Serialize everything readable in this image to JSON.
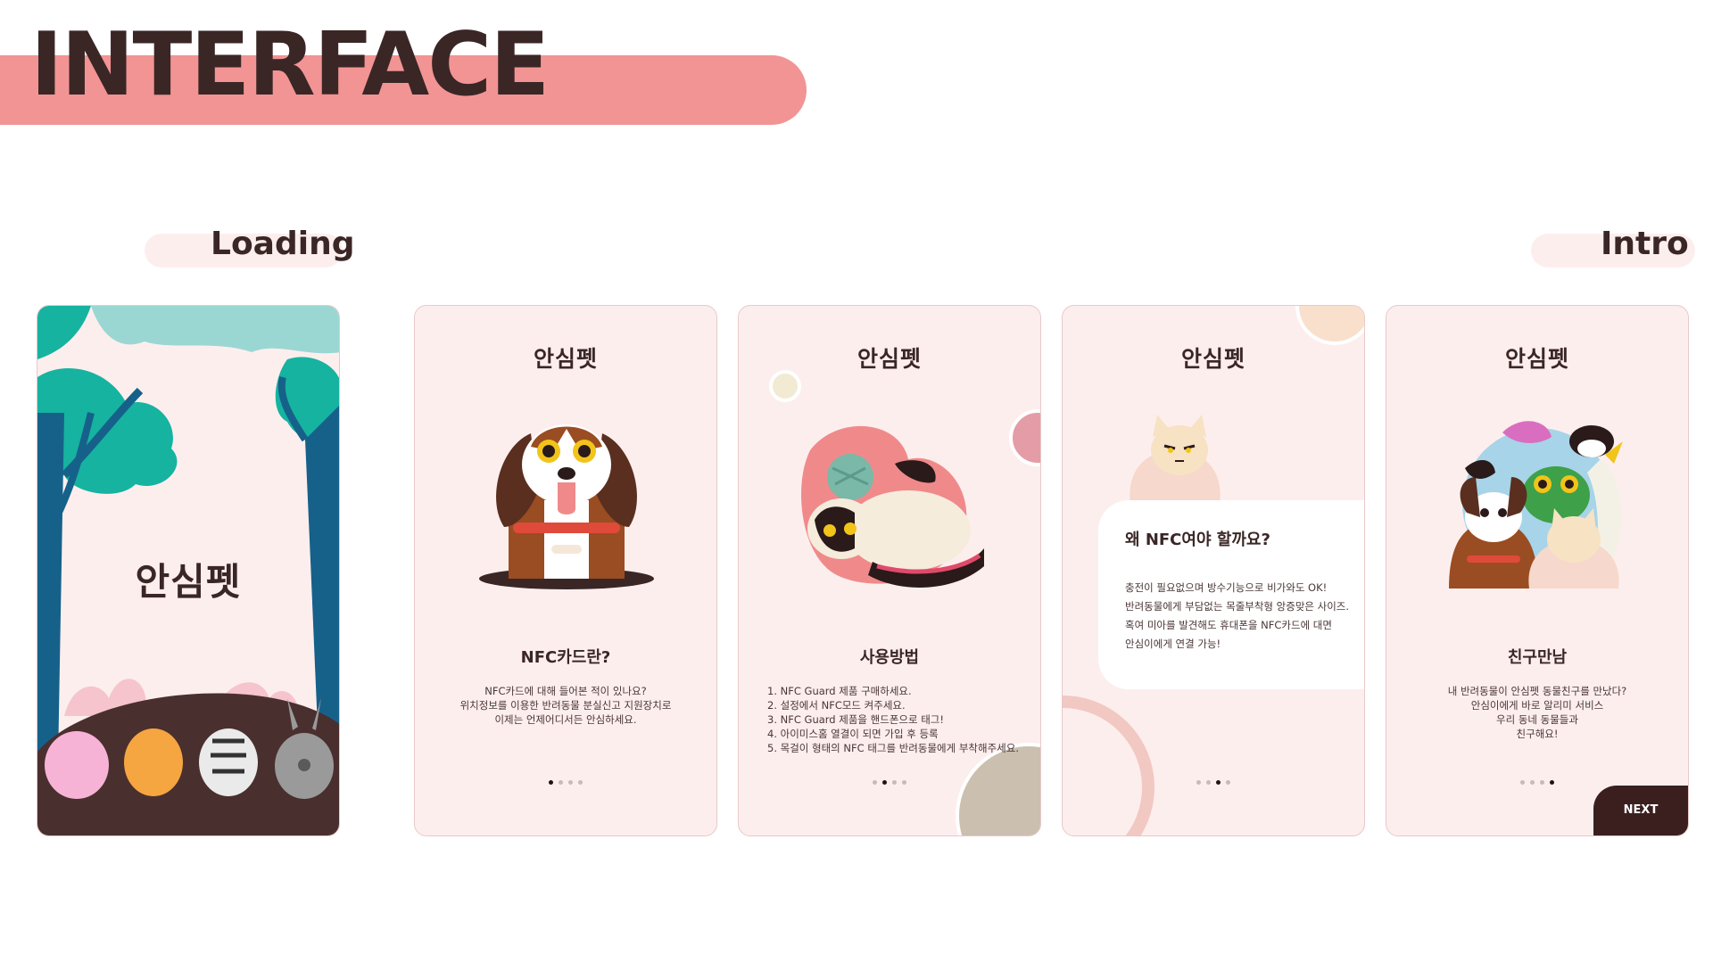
{
  "header": {
    "title": "INTERFACE"
  },
  "sections": {
    "loading": "Loading",
    "intro": "Intro"
  },
  "colors": {
    "accent": "#f29494",
    "screen_bg": "#fdeeee",
    "dark": "#3b2626",
    "teal": "#16b3a0",
    "navy": "#16618a"
  },
  "loading_screen": {
    "logo": "안심펫"
  },
  "intro_screens": [
    {
      "logo": "안심펫",
      "heading": "NFC카드란?",
      "lines": [
        "NFC카드에 대해 들어본 적이 있나요?",
        "위치정보를 이용한 반려동물 분실신고 지원장치로",
        "이제는 언제어디서든 안심하세요."
      ]
    },
    {
      "logo": "안심펫",
      "heading": "사용방법",
      "steps": [
        "1.  NFC Guard 제품 구매하세요.",
        "2.  설정에서 NFC모드 켜주세요.",
        "3.  NFC Guard 제품을 핸드폰으로 태그!",
        "4.  아이미스홈 열결이 되면 가입 후 등록",
        "5.  목걸이 형태의 NFC 태그를 반려동물에게 부착해주세요."
      ]
    },
    {
      "logo": "안심펫",
      "card_heading": "왜 NFC여야 할까요?",
      "card_lines": [
        "충전이 필요없으며 방수기능으로 비가와도 OK!",
        "반려동물에게 부담없는 목줄부착형 앙증맞은 사이즈.",
        "혹여 미아를 발견해도 휴대폰을 NFC카드에 대면",
        "안심이에게 연결 가능!"
      ]
    },
    {
      "logo": "안심펫",
      "heading": "친구만남",
      "lines": [
        "내 반려동물이 안심펫 동물친구를 만났다?",
        "안심이에게 바로 알리미 서비스",
        "우리 동네 동물들과",
        "친구해요!"
      ],
      "next_label": "NEXT"
    }
  ],
  "page_indicator": {
    "total": 4
  }
}
